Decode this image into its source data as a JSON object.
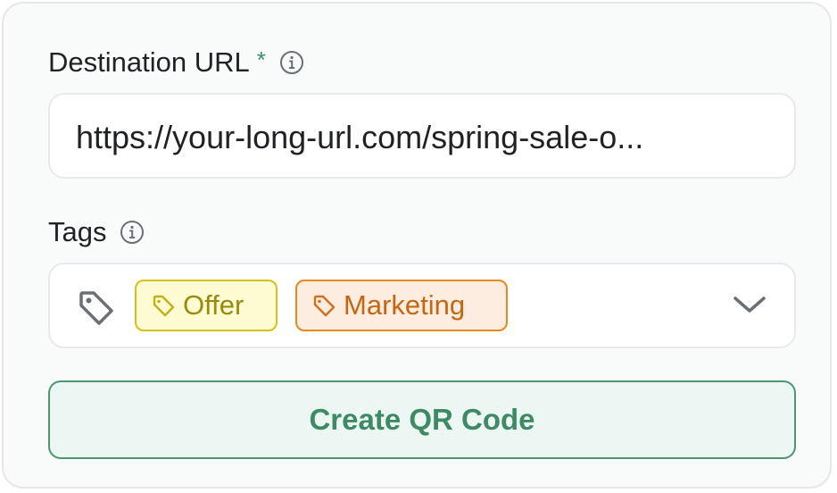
{
  "form": {
    "destination": {
      "label": "Destination URL",
      "required_marker": "*",
      "value": "https://your-long-url.com/spring-sale-o..."
    },
    "tags": {
      "label": "Tags",
      "selected": [
        {
          "label": "Offer",
          "color": "#d4c21a"
        },
        {
          "label": "Marketing",
          "color": "#e8891c"
        }
      ]
    },
    "submit_label": "Create QR Code"
  },
  "colors": {
    "accent": "#3f8f66",
    "offer_bg": "#fdfbd2",
    "marketing_bg": "#fdece0"
  },
  "icons": [
    "info-icon",
    "tag-icon",
    "chevron-down-icon"
  ]
}
